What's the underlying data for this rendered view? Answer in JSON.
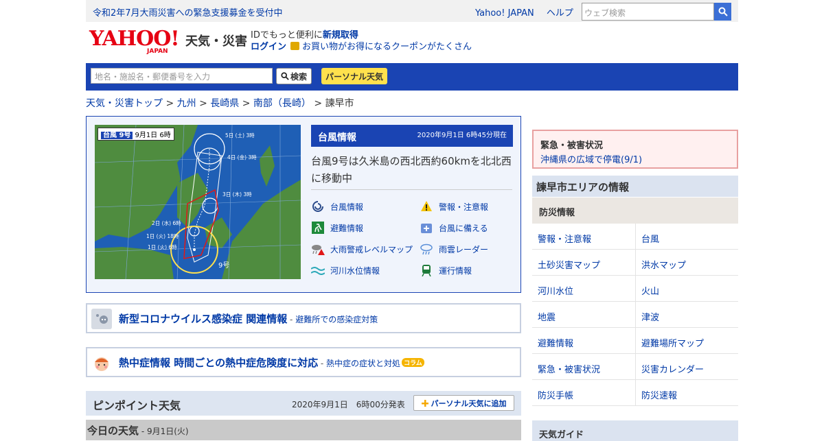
{
  "topbar": {
    "notice": "令和2年7月大雨災害への緊急支援募金を受付中",
    "yahoo_link": "Yahoo! JAPAN",
    "help_link": "ヘルプ",
    "web_search_placeholder": "ウェブ検索"
  },
  "header": {
    "logo_text": "YAHOO!",
    "logo_japan": "JAPAN",
    "service_name": "天気・災害",
    "id_text": "IDでもっと便利に",
    "id_link": "新規取得",
    "login_link": "ログイン",
    "coupon_text": "お買い物がお得になるクーポンがたくさん"
  },
  "search": {
    "placeholder": "地名・施設名・郵便番号を入力",
    "button": "検索",
    "personal_button": "パーソナル天気"
  },
  "breadcrumb": {
    "items": [
      "天気・災害トップ",
      "九州",
      "長崎県",
      "南部（長崎）"
    ],
    "current": "諫早市",
    "sep": ">"
  },
  "typhoon": {
    "map_label_name": "台風 9号",
    "map_label_time": "9月1日 6時",
    "map_texts": {
      "d5": "5日 (土) 3時",
      "d4": "4日 (金) 3時",
      "d3": "3日 (木) 3時",
      "d2": "2日 (水) 6時",
      "d1a": "1日 (火) 18時",
      "d1b": "1日 (火) 6時",
      "num": "9号"
    },
    "title": "台風情報",
    "datetime": "2020年9月1日 6時45分現在",
    "message": "台風9号は久米島の西北西約60kmを北北西に移動中",
    "links": [
      {
        "label": "台風情報",
        "icon": "typhoon-icon"
      },
      {
        "label": "警報・注意報",
        "icon": "warning-icon"
      },
      {
        "label": "避難情報",
        "icon": "evacuation-icon"
      },
      {
        "label": "台風に備える",
        "icon": "prepare-icon"
      },
      {
        "label": "大雨警戒レベルマップ",
        "icon": "rain-level-icon"
      },
      {
        "label": "雨雲レーダー",
        "icon": "rain-radar-icon"
      },
      {
        "label": "河川水位情報",
        "icon": "river-icon"
      },
      {
        "label": "運行情報",
        "icon": "train-icon"
      }
    ]
  },
  "banners": {
    "corona": {
      "main": "新型コロナウイルス感染症 関連情報",
      "dash": " - ",
      "sub": "避難所での感染症対策"
    },
    "heat": {
      "main": "熱中症情報 時間ごとの熱中症危険度に対応",
      "dash": " - ",
      "sub": "熱中症の症状と対処",
      "tag": "コラム"
    }
  },
  "pinpoint": {
    "title": "ピンポイント天気",
    "published": "2020年9月1日　6時00分発表",
    "add_button": "パーソナル天気に追加"
  },
  "today": {
    "title": "今日の天気",
    "date": " - 9月1日(火)"
  },
  "right": {
    "alert_title": "緊急・被害状況",
    "alert_value": "沖縄県の広域で停電(9/1)",
    "area_title": "諫早市エリアの情報",
    "section_title": "防災情報",
    "items": [
      "警報・注意報",
      "台風",
      "土砂災害マップ",
      "洪水マップ",
      "河川水位",
      "火山",
      "地震",
      "津波",
      "避難情報",
      "避難場所マップ",
      "緊急・被害状況",
      "災害カレンダー",
      "防災手帳",
      "防災速報"
    ],
    "bottom_title": "天気ガイド"
  },
  "colors": {
    "accent": "#1a44b3",
    "link": "#0039a6",
    "alert_border": "#e8a0a0",
    "personal": "#ffe14d"
  }
}
